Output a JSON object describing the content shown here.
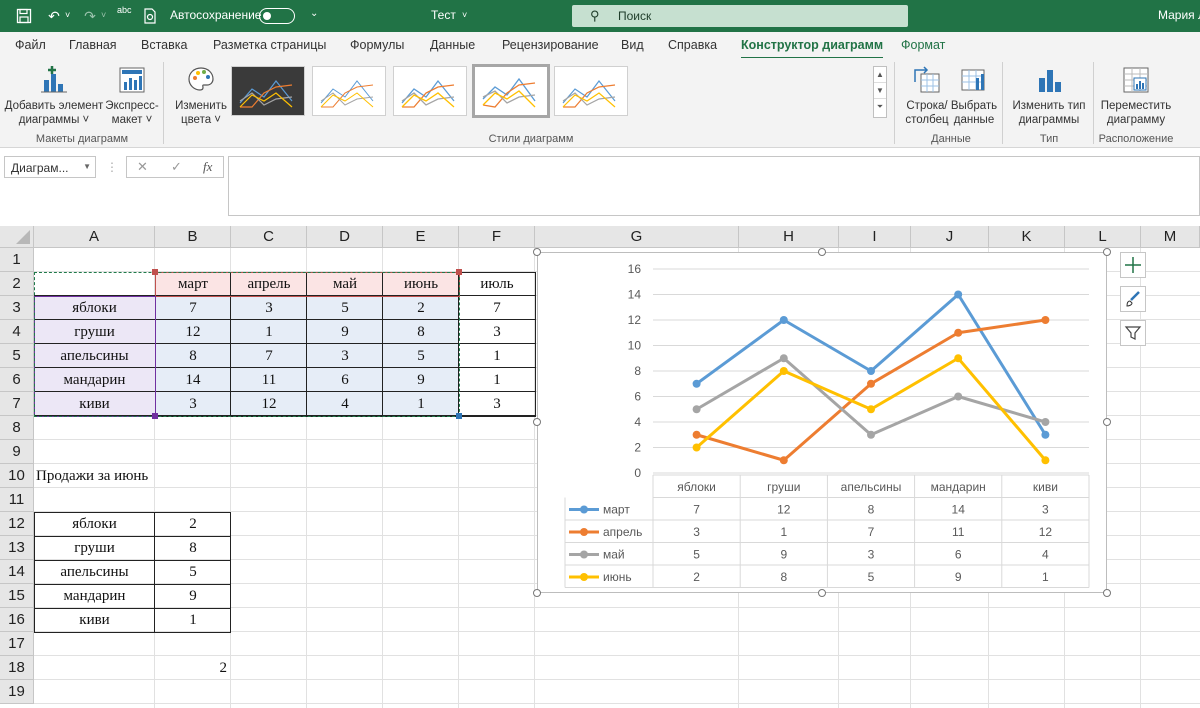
{
  "titlebar": {
    "autosave_label": "Автосохранение",
    "doc_title": "Тест",
    "search_placeholder": "Поиск",
    "user": "Мария Л",
    "spell_icon_label": "abc"
  },
  "tabs": [
    "Файл",
    "Главная",
    "Вставка",
    "Разметка страницы",
    "Формулы",
    "Данные",
    "Рецензирование",
    "Вид",
    "Справка",
    "Конструктор диаграмм",
    "Формат"
  ],
  "active_tab": "Конструктор диаграмм",
  "ribbon": {
    "add_element": "Добавить элемент",
    "add_element_2": "диаграммы ˅",
    "quick_layout": "Экспресс-",
    "quick_layout_2": "макет ˅",
    "change_colors": "Изменить",
    "change_colors_2": "цвета ˅",
    "switch_row_col": "Строка/",
    "switch_row_col_2": "столбец",
    "select_data": "Выбрать",
    "select_data_2": "данные",
    "change_type": "Изменить тип",
    "change_type_2": "диаграммы",
    "move_chart": "Переместить",
    "move_chart_2": "диаграмму",
    "groups": {
      "layouts": "Макеты диаграмм",
      "styles": "Стили диаграмм",
      "data": "Данные",
      "type": "Тип",
      "location": "Расположение"
    }
  },
  "formula_bar": {
    "name_box": "Диаграм...",
    "fx": "fx",
    "cancel": "✕",
    "enter": "✓"
  },
  "columns": [
    "A",
    "B",
    "C",
    "D",
    "E",
    "F",
    "G",
    "H",
    "I",
    "J",
    "K",
    "L",
    "M"
  ],
  "rows": [
    "1",
    "2",
    "3",
    "4",
    "5",
    "6",
    "7",
    "8",
    "9",
    "10",
    "11",
    "12",
    "13",
    "14",
    "15",
    "16",
    "17",
    "18",
    "19"
  ],
  "table1": {
    "headers": [
      "март",
      "апрель",
      "май",
      "июнь",
      "июль"
    ],
    "rows": [
      {
        "fruit": "яблоки",
        "values": [
          "7",
          "3",
          "5",
          "2",
          "7"
        ]
      },
      {
        "fruit": "груши",
        "values": [
          "12",
          "1",
          "9",
          "8",
          "3"
        ]
      },
      {
        "fruit": "апельсины",
        "values": [
          "8",
          "7",
          "3",
          "5",
          "1"
        ]
      },
      {
        "fruit": "мандарин",
        "values": [
          "14",
          "11",
          "6",
          "9",
          "1"
        ]
      },
      {
        "fruit": "киви",
        "values": [
          "3",
          "12",
          "4",
          "1",
          "3"
        ]
      }
    ]
  },
  "june_title": "Продажи за июнь",
  "table2": [
    {
      "fruit": "яблоки",
      "value": "2"
    },
    {
      "fruit": "груши",
      "value": "8"
    },
    {
      "fruit": "апельсины",
      "value": "5"
    },
    {
      "fruit": "мандарин",
      "value": "9"
    },
    {
      "fruit": "киви",
      "value": "1"
    }
  ],
  "cell_b18": "2",
  "colors": {
    "excel_green": "#217346",
    "march": "#5b9bd5",
    "april": "#ed7d31",
    "may": "#a5a5a5",
    "june": "#ffc000"
  },
  "chart_data": {
    "type": "line",
    "categories": [
      "яблоки",
      "груши",
      "апельсины",
      "мандарин",
      "киви"
    ],
    "series": [
      {
        "name": "март",
        "values": [
          7,
          12,
          8,
          14,
          3
        ],
        "color": "#5b9bd5"
      },
      {
        "name": "апрель",
        "values": [
          3,
          1,
          7,
          11,
          12
        ],
        "color": "#ed7d31"
      },
      {
        "name": "май",
        "values": [
          5,
          9,
          3,
          6,
          4
        ],
        "color": "#a5a5a5"
      },
      {
        "name": "июнь",
        "values": [
          2,
          8,
          5,
          9,
          1
        ],
        "color": "#ffc000"
      }
    ],
    "ylim": [
      0,
      16
    ],
    "yticks": [
      "0",
      "2",
      "4",
      "6",
      "8",
      "10",
      "12",
      "14",
      "16"
    ],
    "data_table": true,
    "legend": "data-table"
  }
}
